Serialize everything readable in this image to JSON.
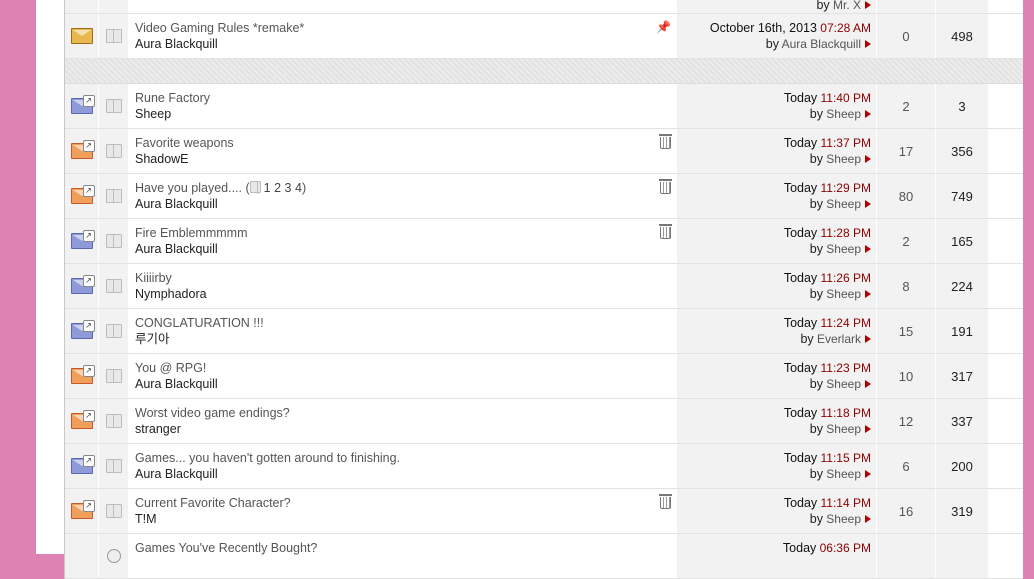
{
  "sticky_partial": {
    "by": "by",
    "user": "Mr. X"
  },
  "sticky": {
    "title": "Video Gaming Rules *remake*",
    "author": "Aura Blackquill",
    "date": "October 16th, 2013",
    "time": "07:28 AM",
    "by": "by",
    "last_user": "Aura Blackquill",
    "replies": "0",
    "views": "498"
  },
  "threads": [
    {
      "title": "Rune Factory",
      "author": "Sheep",
      "date": "Today",
      "time": "11:40 PM",
      "by": "by",
      "last_user": "Sheep",
      "replies": "2",
      "views": "3",
      "status": "blue",
      "trash": false
    },
    {
      "title": "Favorite weapons",
      "author": "ShadowE",
      "date": "Today",
      "time": "11:37 PM",
      "by": "by",
      "last_user": "Sheep",
      "replies": "17",
      "views": "356",
      "status": "red",
      "trash": true
    },
    {
      "title": "Have you played....",
      "author": "Aura Blackquill",
      "date": "Today",
      "time": "11:29 PM",
      "by": "by",
      "last_user": "Sheep",
      "replies": "80",
      "views": "749",
      "status": "red",
      "trash": true,
      "pages": [
        "1",
        "2",
        "3",
        "4"
      ]
    },
    {
      "title": "Fire Emblemmmmm",
      "author": "Aura Blackquill",
      "date": "Today",
      "time": "11:28 PM",
      "by": "by",
      "last_user": "Sheep",
      "replies": "2",
      "views": "165",
      "status": "blue",
      "trash": true
    },
    {
      "title": "Kiiiirby",
      "author": "Nymphadora",
      "date": "Today",
      "time": "11:26 PM",
      "by": "by",
      "last_user": "Sheep",
      "replies": "8",
      "views": "224",
      "status": "blue",
      "trash": false
    },
    {
      "title": "CONGLATURATION !!!",
      "author": "루기아",
      "date": "Today",
      "time": "11:24 PM",
      "by": "by",
      "last_user": "Everlark",
      "replies": "15",
      "views": "191",
      "status": "blue",
      "trash": false
    },
    {
      "title": "You @ RPG!",
      "author": "Aura Blackquill",
      "date": "Today",
      "time": "11:23 PM",
      "by": "by",
      "last_user": "Sheep",
      "replies": "10",
      "views": "317",
      "status": "red",
      "trash": false
    },
    {
      "title": "Worst video game endings?",
      "author": "stranger",
      "date": "Today",
      "time": "11:18 PM",
      "by": "by",
      "last_user": "Sheep",
      "replies": "12",
      "views": "337",
      "status": "red",
      "trash": false
    },
    {
      "title": "Games... you haven't gotten around to finishing.",
      "author": "Aura Blackquill",
      "date": "Today",
      "time": "11:15 PM",
      "by": "by",
      "last_user": "Sheep",
      "replies": "6",
      "views": "200",
      "status": "blue",
      "trash": false
    },
    {
      "title": "Current Favorite Character?",
      "author": "T!M",
      "date": "Today",
      "time": "11:14 PM",
      "by": "by",
      "last_user": "Sheep",
      "replies": "16",
      "views": "319",
      "status": "red",
      "trash": true
    }
  ],
  "partial_last": {
    "title": "Games You've Recently Bought?",
    "date": "Today",
    "time": "06:36 PM"
  },
  "colors": {
    "background": "#de82b3",
    "time": "#8b0000",
    "arrow": "#b00000"
  }
}
